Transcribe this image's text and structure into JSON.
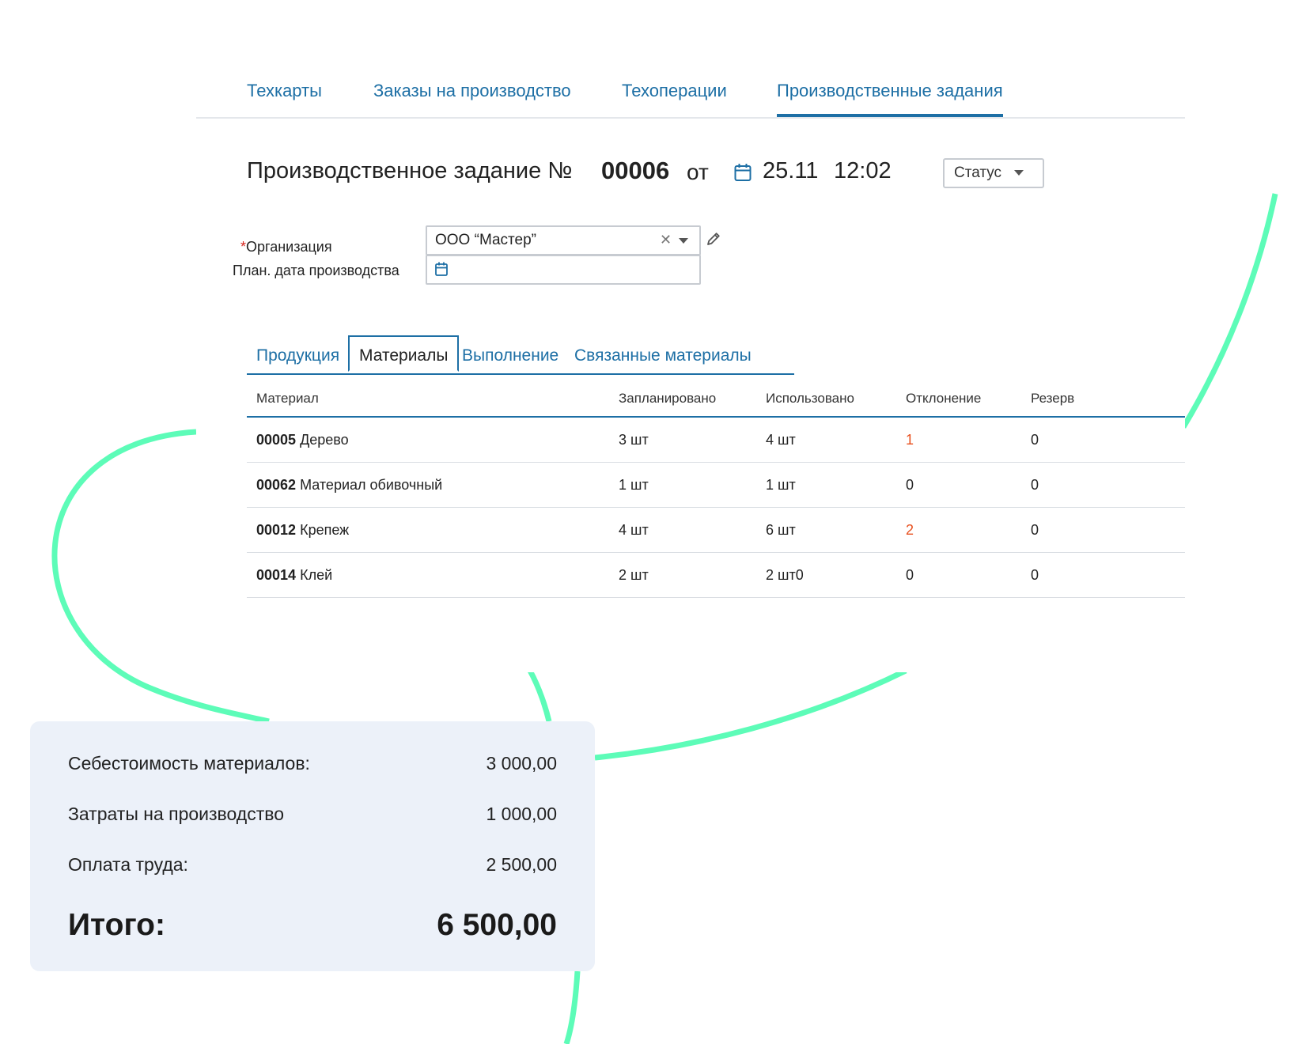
{
  "nav_tabs": [
    {
      "label": "Техкарты",
      "active": false
    },
    {
      "label": "Заказы на производство",
      "active": false
    },
    {
      "label": "Техоперации",
      "active": false
    },
    {
      "label": "Производственные задания",
      "active": true
    }
  ],
  "document": {
    "title": "Производственное задание №",
    "number": "00006",
    "from_label": "от",
    "date": "25.11",
    "time": "12:02",
    "status_label": "Статус"
  },
  "form": {
    "organization": {
      "required_mark": "*",
      "label": "Организация",
      "value": "ООО “Мастер”"
    },
    "plan_date": {
      "label": "План. дата производства",
      "value": ""
    }
  },
  "inner_tabs": [
    {
      "label": "Продукция",
      "active": false
    },
    {
      "label": "Материалы",
      "active": true
    },
    {
      "label": "Выполнение",
      "active": false
    },
    {
      "label": "Связанные материалы",
      "active": false
    }
  ],
  "table": {
    "columns": [
      "Материал",
      "Запланировано",
      "Использовано",
      "Отклонение",
      "Резерв"
    ],
    "rows": [
      {
        "code": "00005",
        "name": "Дерево",
        "planned": "3 шт",
        "used": "4 шт",
        "deviation": "1",
        "reserve": "0",
        "deviation_highlight": true
      },
      {
        "code": "00062",
        "name": "Материал обивочный",
        "planned": "1 шт",
        "used": "1 шт",
        "deviation": "0",
        "reserve": "0",
        "deviation_highlight": false
      },
      {
        "code": "00012",
        "name": "Крепеж",
        "planned": "4 шт",
        "used": "6 шт",
        "deviation": "2",
        "reserve": "0",
        "deviation_highlight": true
      },
      {
        "code": "00014",
        "name": "Клей",
        "planned": "2 шт",
        "used": "2 шт0",
        "deviation": "0",
        "reserve": "0",
        "deviation_highlight": false
      }
    ]
  },
  "summary": {
    "materials_cost_label": "Себестоимость материалов:",
    "materials_cost_value": "3 000,00",
    "production_costs_label": "Затраты на производство",
    "production_costs_value": "1 000,00",
    "labor_label": "Оплата труда:",
    "labor_value": "2 500,00",
    "total_label": "Итого:",
    "total_value": "6 500,00"
  },
  "icons": [
    "calendar-icon",
    "caret-down-icon",
    "clear-icon",
    "pencil-icon"
  ],
  "colors": {
    "accent": "#1d6fa5",
    "warning": "#e8501e",
    "decor_curve": "#5dfcb8",
    "summary_bg": "#ecf1f9"
  }
}
